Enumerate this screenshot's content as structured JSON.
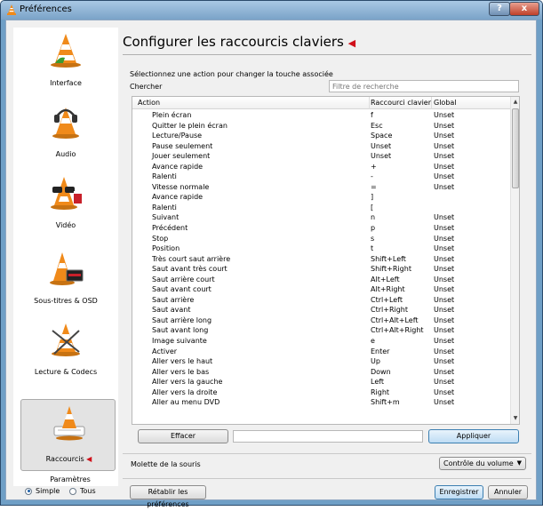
{
  "window": {
    "title": "Préférences",
    "help_label": "?",
    "close_label": "x"
  },
  "sidebar": {
    "items": [
      {
        "label": "Interface",
        "icon": "vlc-cone-icon"
      },
      {
        "label": "Audio",
        "icon": "headphones-cone-icon"
      },
      {
        "label": "Vidéo",
        "icon": "glasses-cone-icon"
      },
      {
        "label": "Sous-titres & OSD",
        "icon": "subtitles-cone-icon"
      },
      {
        "label": "Lecture & Codecs",
        "icon": "codecs-cone-icon"
      },
      {
        "label": "Raccourcis",
        "icon": "keyboard-cone-icon"
      }
    ],
    "params_title": "Paramètres",
    "mode_simple": "Simple",
    "mode_all": "Tous"
  },
  "main": {
    "title": "Configurer les raccourcis claviers",
    "hint": "Sélectionnez une action pour changer la touche associée",
    "search_label": "Chercher",
    "search_placeholder": "Filtre de recherche",
    "columns": [
      "Action",
      "Raccourci clavier",
      "Global"
    ],
    "rows": [
      [
        "Plein écran",
        "f",
        "Unset"
      ],
      [
        "Quitter le plein écran",
        "Esc",
        "Unset"
      ],
      [
        "Lecture/Pause",
        "Space",
        "Unset"
      ],
      [
        "Pause seulement",
        "Unset",
        "Unset"
      ],
      [
        "Jouer seulement",
        "Unset",
        "Unset"
      ],
      [
        "Avance rapide",
        "+",
        "Unset"
      ],
      [
        "Ralenti",
        "-",
        "Unset"
      ],
      [
        "Vitesse normale",
        "=",
        "Unset"
      ],
      [
        "Avance rapide",
        "]",
        ""
      ],
      [
        "Ralenti",
        "[",
        ""
      ],
      [
        "Suivant",
        "n",
        "Unset"
      ],
      [
        "Précédent",
        "p",
        "Unset"
      ],
      [
        "Stop",
        "s",
        "Unset"
      ],
      [
        "Position",
        "t",
        "Unset"
      ],
      [
        "Très court saut arrière",
        "Shift+Left",
        "Unset"
      ],
      [
        "Saut avant très court",
        "Shift+Right",
        "Unset"
      ],
      [
        "Saut arrière court",
        "Alt+Left",
        "Unset"
      ],
      [
        "Saut avant court",
        "Alt+Right",
        "Unset"
      ],
      [
        "Saut arrière",
        "Ctrl+Left",
        "Unset"
      ],
      [
        "Saut avant",
        "Ctrl+Right",
        "Unset"
      ],
      [
        "Saut arrière long",
        "Ctrl+Alt+Left",
        "Unset"
      ],
      [
        "Saut avant long",
        "Ctrl+Alt+Right",
        "Unset"
      ],
      [
        "Image suivante",
        "e",
        "Unset"
      ],
      [
        "Activer",
        "Enter",
        "Unset"
      ],
      [
        "Aller vers le haut",
        "Up",
        "Unset"
      ],
      [
        "Aller vers le bas",
        "Down",
        "Unset"
      ],
      [
        "Aller vers la gauche",
        "Left",
        "Unset"
      ],
      [
        "Aller vers la droite",
        "Right",
        "Unset"
      ],
      [
        "Aller au menu DVD",
        "Shift+m",
        "Unset"
      ]
    ],
    "clear_label": "Effacer",
    "apply_label": "Appliquer",
    "mouse_label": "Molette de la souris",
    "mouse_option": "Contrôle du volume"
  },
  "footer": {
    "reset_label": "Rétablir les préférences",
    "save_label": "Enregistrer",
    "cancel_label": "Annuler"
  },
  "colors": {
    "accent_red": "#d0101a",
    "vlc_orange": "#f08a1a",
    "apply_blue": "#3c7fb1"
  }
}
